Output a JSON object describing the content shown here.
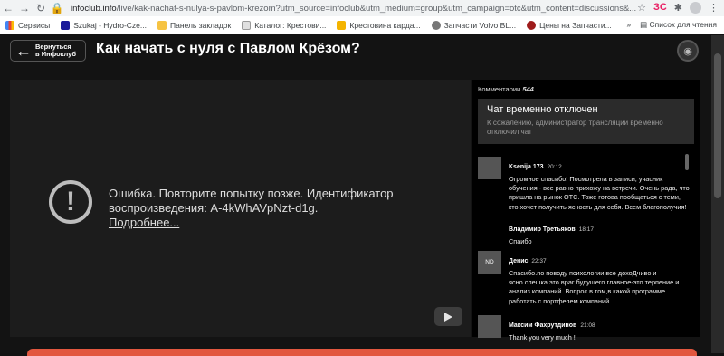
{
  "browser": {
    "url_host": "infoclub.info",
    "url_path": "/live/kak-nachat-s-nulya-s-pavlom-krezom?utm_source=infoclub&utm_medium=group&utm_campaign=otc&utm_content=discussions&...",
    "bookmarks": [
      "Сервисы",
      "Szukaj - Hydro-Cze...",
      "Панель закладок",
      "Каталог: Крестови...",
      "Крестовина кардa...",
      "Запчасти Volvo BL...",
      "Цены на Запчасти..."
    ],
    "bookmarks_more": "»",
    "reading_list": "Список для чтения"
  },
  "header": {
    "back_line1": "Вернуться",
    "back_line2": "в Инфоклуб",
    "title": "Как начать с нуля с Павлом Крёзом?"
  },
  "player": {
    "error_text": "Ошибка. Повторите попытку позже. Идентификатор воспроизведения: A-4kWhAVpNzt-d1g.",
    "more_link": "Подробнее..."
  },
  "chat": {
    "comments_label": "Комментарии",
    "comments_count": "544",
    "disabled_title": "Чат временно отключен",
    "disabled_desc": "К сожалению, администратор трансляции временно отключил чат",
    "messages": [
      {
        "name": "Ksenija 173",
        "time": "20:12",
        "text": "Огромное спасибо! Посмотрела в записи, учасник обучения - все равно прихожу на встречи. Очень рада, что пришла на рынок OTC. Тоже готова пообщаться с теми, кто хочет получить ясность для себя. Всем благополучия!"
      },
      {
        "name": "Владимир Третьяков",
        "time": "18:17",
        "text": "Спаибо"
      },
      {
        "name": "Денис",
        "time": "22:37",
        "avatar_text": "ND",
        "text": "Спасибо.по поводу психологии все дохоДчиво и ясно.слешка это враг будущего.главное-это терпение и анализ компаний. Вопрос в том,в какой программе работать с портфелем компаний."
      },
      {
        "name": "Максим Фахрутдинов",
        "time": "21:08",
        "text": "Thank you very much !"
      }
    ]
  }
}
